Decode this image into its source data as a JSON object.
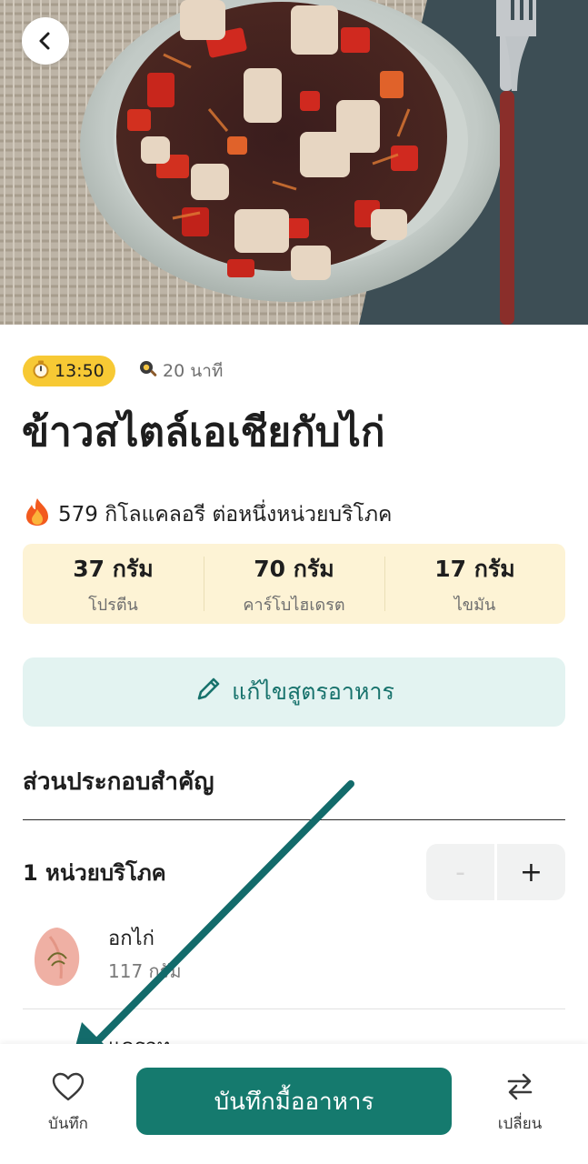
{
  "recipe": {
    "time_badge": "13:50",
    "cook_time": "20 นาที",
    "title": "ข้าวสไตล์เอเชียกับไก่",
    "calories_text": "579 กิโลแคลอรี ต่อหนึ่งหน่วยบริโภค"
  },
  "macros": [
    {
      "value": "37 กรัม",
      "label": "โปรตีน"
    },
    {
      "value": "70 กรัม",
      "label": "คาร์โบไฮเดรต"
    },
    {
      "value": "17 กรัม",
      "label": "ไขมัน"
    }
  ],
  "edit_button_label": "แก้ไขสูตรอาหาร",
  "ingredients_section": {
    "title": "ส่วนประกอบสำคัญ",
    "serving_label": "1 หน่วยบริโภค",
    "minus_label": "-",
    "plus_label": "+",
    "items": [
      {
        "name": "อกไก่",
        "amount": "117 กรัม"
      },
      {
        "name": "แครอท"
      }
    ]
  },
  "bottom_bar": {
    "save_label": "บันทึก",
    "log_meal_label": "บันทึกมื้ออาหาร",
    "swap_label": "เปลี่ยน"
  },
  "colors": {
    "accent": "#157a6e",
    "time_badge_bg": "#f7c934",
    "macro_bg": "#fdf3d5",
    "edit_bg": "#e3f3f1",
    "annotation_arrow": "#136b6b"
  },
  "icons": {
    "back": "chevron-left-icon",
    "time": "stopwatch-icon",
    "cook": "frying-pan-icon",
    "calories": "fire-icon",
    "edit": "pencil-icon",
    "save": "heart-icon",
    "swap": "swap-arrows-icon"
  }
}
